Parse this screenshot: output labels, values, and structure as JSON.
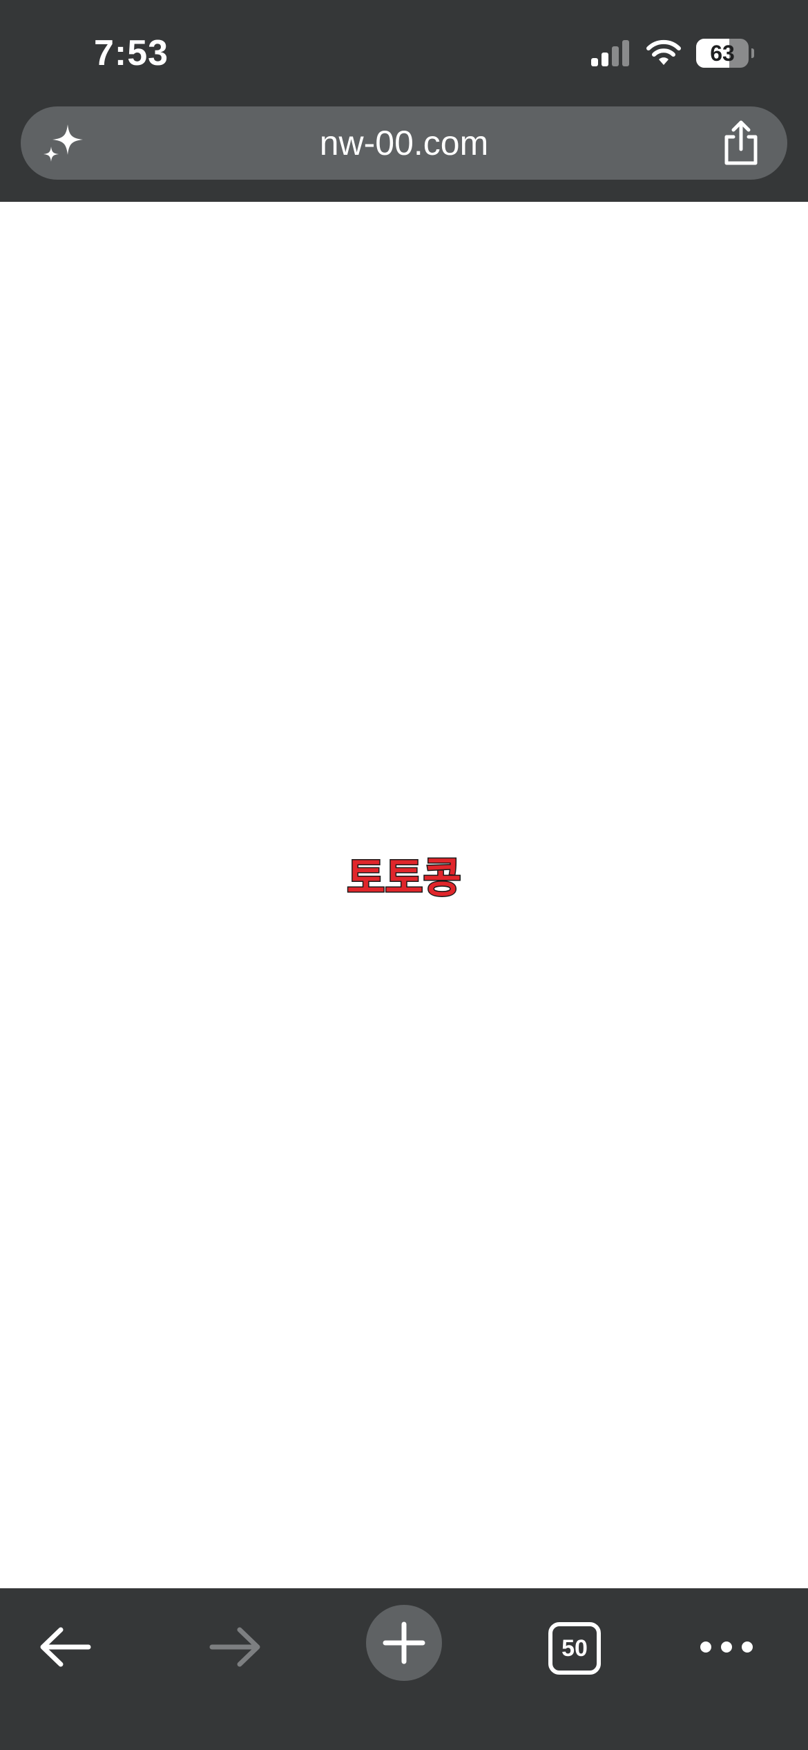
{
  "status_bar": {
    "time": "7:53",
    "battery_percent": "63",
    "battery_level": 0.63
  },
  "address_bar": {
    "url": "nw-00.com",
    "left_icon": "sparkle-icon",
    "right_icon": "share-icon"
  },
  "page": {
    "logo_text": "토토콩",
    "logo_color": "#e0262b",
    "logo_outline_color": "#1a1a1a"
  },
  "toolbar": {
    "tab_count": "50",
    "icons": [
      "back-arrow-icon",
      "forward-arrow-icon",
      "plus-icon",
      "tabs-icon",
      "more-icon"
    ]
  },
  "colors": {
    "chrome_background": "#353738",
    "address_bar_background": "#5f6264",
    "page_background": "#ffffff"
  }
}
